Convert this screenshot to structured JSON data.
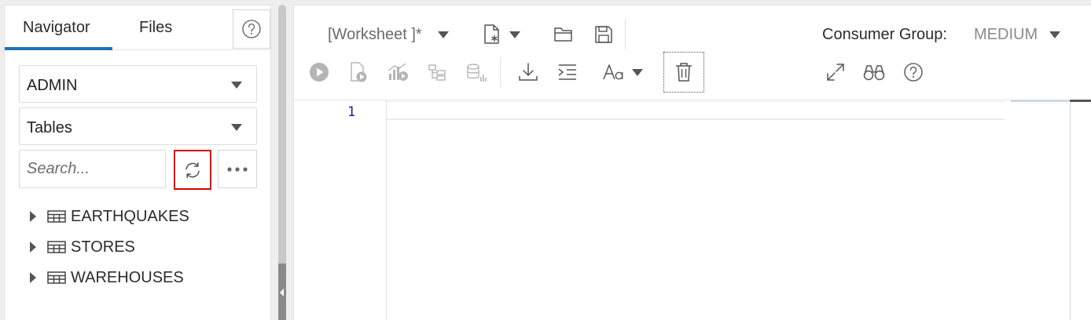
{
  "navigator": {
    "tabs": [
      {
        "label": "Navigator",
        "active": true
      },
      {
        "label": "Files",
        "active": false
      }
    ],
    "help_icon": "help-circle-icon",
    "schema_select": {
      "value": "ADMIN"
    },
    "object_type_select": {
      "value": "Tables"
    },
    "search": {
      "value": "",
      "placeholder": "Search..."
    },
    "refresh_icon": "refresh-icon",
    "more_icon": "more-horizontal-icon",
    "tree": [
      {
        "label": "EARTHQUAKES",
        "icon": "table-icon"
      },
      {
        "label": "STORES",
        "icon": "table-icon"
      },
      {
        "label": "WAREHOUSES",
        "icon": "table-icon"
      }
    ]
  },
  "worksheet": {
    "title": "[Worksheet ]*",
    "consumer_group_label": "Consumer Group:",
    "consumer_group_value": "MEDIUM",
    "toolbar_icons": [
      "new-file-icon",
      "open-folder-icon",
      "save-icon",
      "run-icon",
      "run-script-icon",
      "explain-plan-icon",
      "autotrace-icon",
      "sql-tuning-icon",
      "download-icon",
      "format-icon",
      "font-size-icon",
      "clear-icon",
      "expand-icon",
      "binoculars-icon",
      "help-circle-icon"
    ],
    "editor": {
      "line_numbers": [
        "1"
      ],
      "content": ""
    }
  },
  "colors": {
    "accent": "#1a73b9",
    "highlight_border": "#d40000",
    "line_number": "#1a237e"
  }
}
